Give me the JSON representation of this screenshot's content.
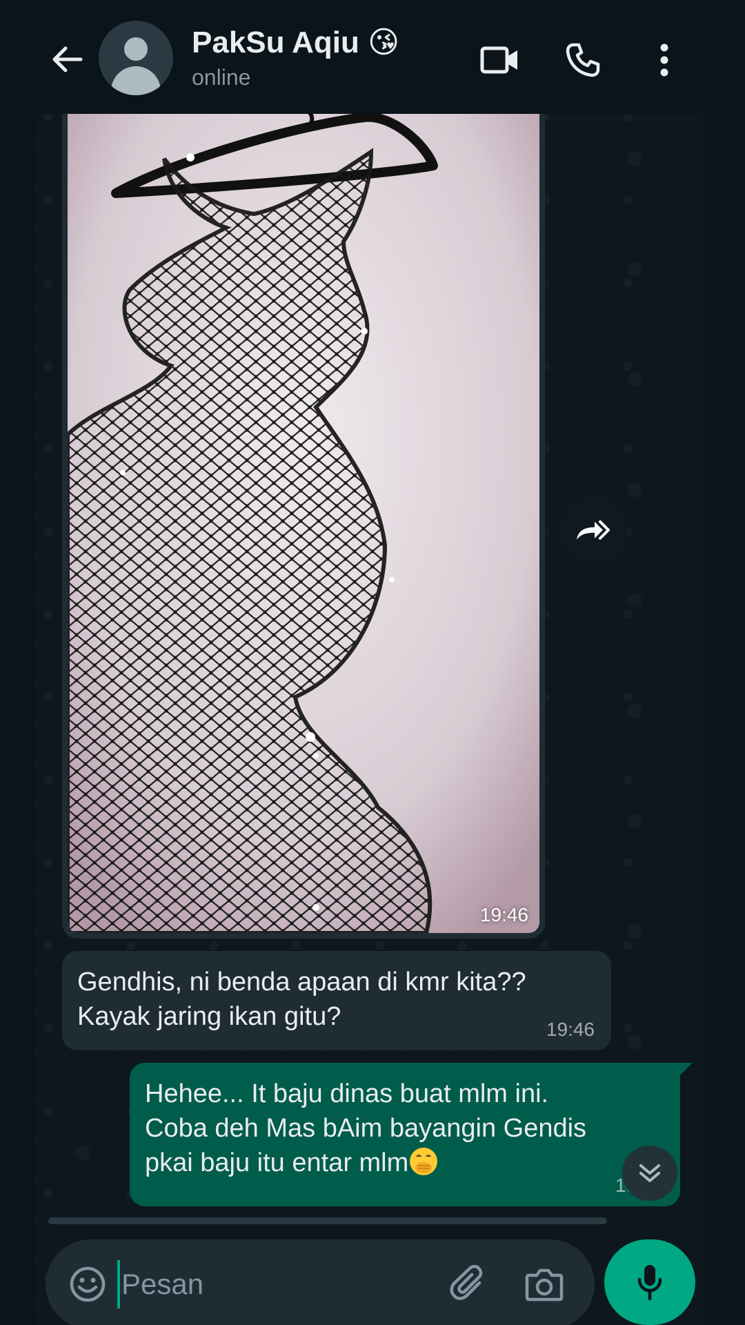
{
  "header": {
    "contact_name": "PakSu Aqiu 😘",
    "status": "online"
  },
  "messages": [
    {
      "type": "image",
      "direction": "incoming",
      "time": "19:46"
    },
    {
      "type": "text",
      "direction": "incoming",
      "lines": [
        "Gendhis, ni benda apaan di kmr kita??",
        "Kayak jaring ikan gitu?"
      ],
      "time": "19:46"
    },
    {
      "type": "text",
      "direction": "outgoing",
      "lines": [
        "Hehee... It baju dinas buat mlm ini.",
        "Coba deh Mas bAim bayangin Gendis",
        "pkai baju itu entar mlm"
      ],
      "time": "19:50"
    }
  ],
  "input": {
    "placeholder": "Pesan",
    "value": ""
  },
  "colors": {
    "background": "#0b141a",
    "incoming_bubble": "#1f2c34",
    "outgoing_bubble": "#005c4b",
    "accent": "#00a884"
  },
  "icons": {
    "back": "arrow-left-icon",
    "video": "video-camera-icon",
    "call": "phone-icon",
    "menu": "more-vertical-icon",
    "forward": "forward-icon",
    "scroll": "chevron-double-down-icon",
    "emoji": "smiley-icon",
    "attach": "paperclip-icon",
    "camera": "camera-icon",
    "mic": "microphone-icon"
  }
}
